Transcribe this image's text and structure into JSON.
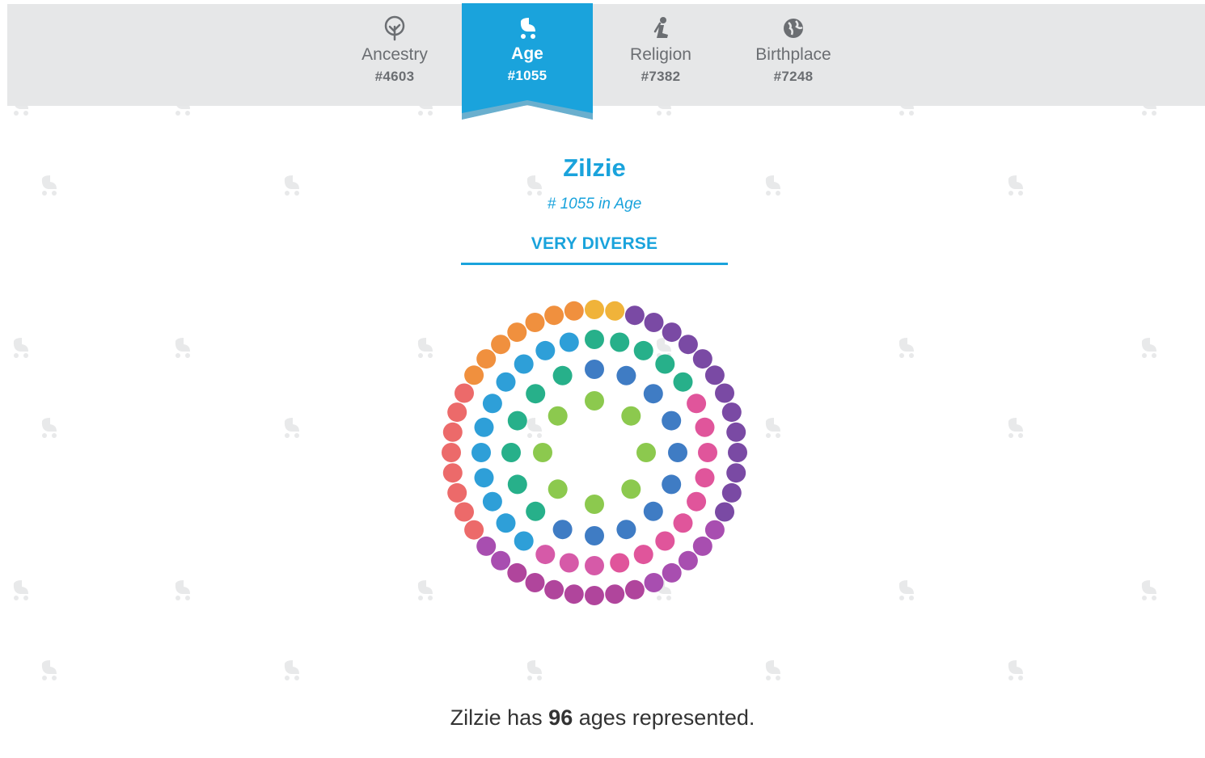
{
  "tabs": [
    {
      "label": "Ancestry",
      "rank": "#4603",
      "icon": "tree-icon",
      "active": false
    },
    {
      "label": "Age",
      "rank": "#1055",
      "icon": "baby-stroller-icon",
      "active": true
    },
    {
      "label": "Religion",
      "rank": "#7382",
      "icon": "praying-person-icon",
      "active": false
    },
    {
      "label": "Birthplace",
      "rank": "#7248",
      "icon": "globe-icon",
      "active": false
    }
  ],
  "place": {
    "name": "Zilzie",
    "rank_text": "# 1055 in Age",
    "diversity": "VERY DIVERSE"
  },
  "summary": {
    "prefix": "Zilzie has ",
    "count": "96",
    "suffix": " ages represented."
  },
  "colors": {
    "accent": "#1aa3dc",
    "tab_bar": "#e6e7e8",
    "text": "#333333"
  },
  "chart_data": {
    "type": "dot-cluster",
    "total_dots": 96,
    "rings": [
      {
        "ring": "outer",
        "count": 44,
        "colors": [
          "#f0a53c",
          "#f0903e",
          "#ec6a6a",
          "#a84eb0",
          "#7a4aa4"
        ]
      },
      {
        "ring": "second",
        "count": 28,
        "colors": [
          "#2e9fd8",
          "#27b08a",
          "#3f7cc4",
          "#e0559b"
        ]
      },
      {
        "ring": "third",
        "count": 16,
        "colors": [
          "#27b08a",
          "#3f7cc4",
          "#e0559b",
          "#a84eb0"
        ]
      },
      {
        "ring": "inner",
        "count": 8,
        "colors": [
          "#8cc94e"
        ]
      }
    ]
  }
}
